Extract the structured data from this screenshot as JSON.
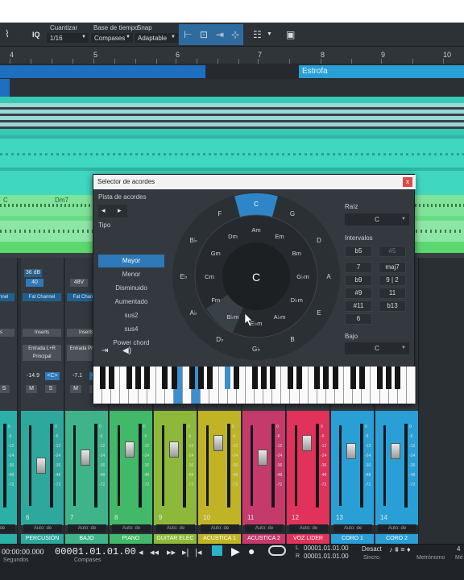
{
  "toolbar": {
    "quantize_label": "Cuantizar",
    "quantize_value": "1/16",
    "timebase_label": "Base de tiempo",
    "timebase_value": "Compases",
    "snap_label": "Snap",
    "snap_value": "Adaptable",
    "iq_label": "IQ"
  },
  "ruler": {
    "marks": [
      "4",
      "5",
      "6",
      "7",
      "8",
      "9",
      "10"
    ]
  },
  "arranger": {
    "section_label": "Estrofa"
  },
  "chord_lane": {
    "chords": [
      "C",
      "Dm7"
    ]
  },
  "mixer": {
    "strips": [
      {
        "name": "ms",
        "num": "",
        "db": "36 dB",
        "val": "48",
        "input": "",
        "color": "#2bb0a8"
      },
      {
        "name": "PERCUSIÓN",
        "num": "6",
        "db": "36 dB",
        "val": "40",
        "input": "Entrada L+R",
        "bus": "Principal",
        "pan": "<C>",
        "level": "-14.9",
        "color": "#2ea89c"
      },
      {
        "name": "BAJO",
        "num": "7",
        "db": "",
        "val": "48V",
        "input": "Entrada",
        "bus": "Princip",
        "pan": "<C>",
        "level": "-7.1",
        "color": "#3fb38a"
      },
      {
        "name": "PIANO",
        "num": "8",
        "color": "#42b869"
      },
      {
        "name": "GUITAR ELEC",
        "num": "9",
        "color": "#8db83a"
      },
      {
        "name": "ACUSTICA 1",
        "num": "10",
        "color": "#c0b426"
      },
      {
        "name": "ACUSTICA 2",
        "num": "11",
        "color": "#c43a6a"
      },
      {
        "name": "VOZ LIDER",
        "num": "12",
        "color": "#e0325a"
      },
      {
        "name": "CORO 1",
        "num": "13",
        "color": "#2a9fd6"
      },
      {
        "name": "CORO 2",
        "num": "14",
        "color": "#2a9fd6"
      }
    ],
    "channel_label": "Fat Channel",
    "inserts_label": "Inserts",
    "auto_label": "Auto: de",
    "mute_label": "M",
    "solo_label": "S",
    "scale_marks": [
      "0",
      "-6",
      "-12",
      "-24",
      "-36",
      "-48",
      "-72"
    ]
  },
  "chord_selector": {
    "title": "Selector de acordes",
    "track_label": "Pista de acordes",
    "type_label": "Tipo",
    "types": [
      "Mayor",
      "Menor",
      "Disminuido",
      "Aumentado",
      "sus2",
      "sus4",
      "Power chord"
    ],
    "selected_type": "Mayor",
    "root_label": "Raíz",
    "root_value": "C",
    "intervals_label": "Intervalos",
    "intervals": [
      "b5",
      "#5",
      "7",
      "maj7",
      "b9",
      "9 | 2",
      "#9",
      "11",
      "#11",
      "b13",
      "6"
    ],
    "bass_label": "Bajo",
    "bass_value": "C",
    "center_chord": "C",
    "outer_ring": [
      "C",
      "G",
      "D",
      "A",
      "E",
      "B",
      "G♭",
      "D♭",
      "A♭",
      "E♭",
      "B♭",
      "F"
    ],
    "inner_ring": [
      "Am",
      "Em",
      "Bm",
      "G♭m",
      "D♭m",
      "A♭m",
      "E♭m",
      "B♭m",
      "Fm",
      "Cm",
      "Gm",
      "Dm"
    ],
    "accent": "#2e86c8"
  },
  "transport": {
    "time_left": "00:00:00.000",
    "time_left_label": "Segundos",
    "position": "00001.01.01.00",
    "position_label": "Compases",
    "loop_l": "00001.01.01.00",
    "loop_r": "00001.01.01.00",
    "sync_label": "Desact",
    "sync_sub": "Sincro.",
    "metro_label": "Metrónomo",
    "extra": "4",
    "extra_sub": "Mé"
  }
}
